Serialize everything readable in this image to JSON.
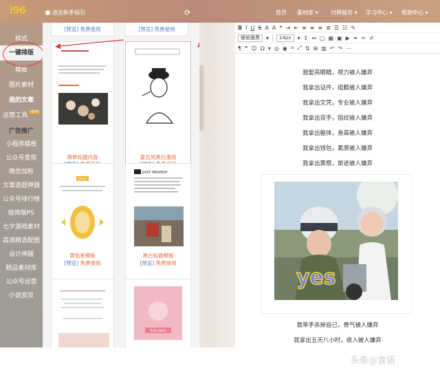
{
  "topbar": {
    "logo": "i96",
    "guide_label": "进击新手指引",
    "refresh_icon": "refresh-icon",
    "nav": [
      "首页",
      "素材库 ▾",
      "付费服务 ▾",
      "学习中心 ▾",
      "帮助中心 ▾"
    ]
  },
  "sidebar": {
    "items": [
      {
        "label": "样式"
      },
      {
        "label": "一键排版"
      },
      {
        "label": "模板"
      },
      {
        "label": "图片素材"
      },
      {
        "label": "我的文章"
      },
      {
        "label": "运营工具",
        "badge": "NEW"
      },
      {
        "label": "广告推广"
      },
      {
        "label": "小程序模板"
      },
      {
        "label": "公众号变现"
      },
      {
        "label": "微信加粉"
      },
      {
        "label": "文章选题神器"
      },
      {
        "label": "公众号排行榜"
      },
      {
        "label": "极简版PS"
      },
      {
        "label": "七夕游戏素材"
      },
      {
        "label": "高清精选配图"
      },
      {
        "label": "设计神器"
      },
      {
        "label": "精品素材库"
      },
      {
        "label": "公众号运营"
      },
      {
        "label": "小说变现"
      }
    ]
  },
  "gallery": {
    "top_left_links": "[预览] 免费使用",
    "top_right_links": "[预览] 免费使用",
    "cards": [
      {
        "title": "简单标题内容",
        "preview": "[预览]",
        "use": "免费使用"
      },
      {
        "title": "复古风黑白漫画",
        "preview": "[预览]",
        "use": "免费使用"
      },
      {
        "title": "黄色系模板",
        "preview": "[预览]",
        "use": "免费使用"
      },
      {
        "title": "黑白标题模板",
        "preview": "[预览]",
        "use": "免费使用"
      }
    ],
    "card4_header": "JUST MOVED!",
    "card3_badge": "2022",
    "card6_banner": "RUN AWAY"
  },
  "toolbar": {
    "font": "微软雅黑",
    "size": "14px"
  },
  "editor": {
    "lines_top": [
      "我娶亮眼睛，视力被人嫌弃",
      "我拿出证件，组籍被人嫌弃",
      "我拿出文凭，专业被人嫌弃",
      "我拿出双手，指纹被人嫌弃",
      "我拿出躯体，身高被人嫌弃",
      "我拿出钱包，素质被人嫌弃",
      "我拿出票根，旅途被人嫌弃"
    ],
    "photo_caption": "yes",
    "lines_bottom": [
      "我举手杀掉自己，骨气被人嫌弃",
      "我拿出五天八小时，收入被人嫌弃"
    ]
  },
  "watermark": "头条@言语",
  "colors": {
    "accent": "#e36a3c",
    "link": "#5a7fc0",
    "highlight_circle": "#d33333"
  }
}
